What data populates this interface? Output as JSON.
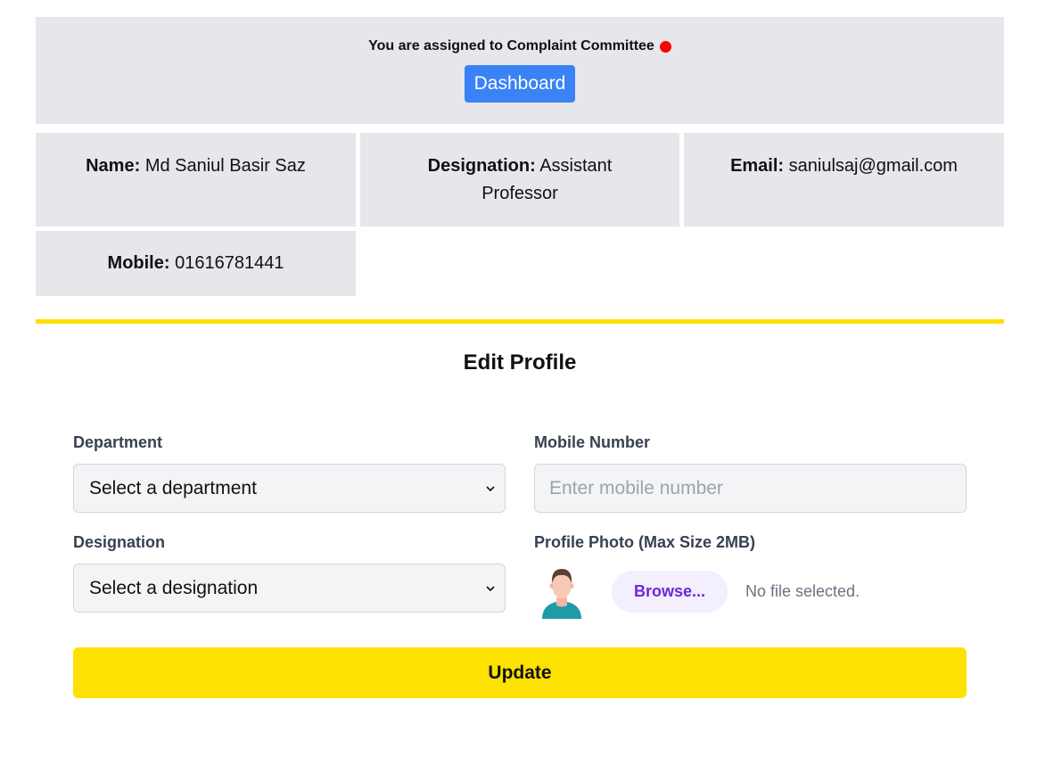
{
  "banner": {
    "assignment_text": "You are assigned to Complaint Committee",
    "status_dot_color": "#ff0000",
    "dashboard_label": "Dashboard"
  },
  "profile": {
    "name_label": "Name:",
    "name_value": "Md Saniul Basir Saz",
    "designation_label": "Designation:",
    "designation_value": "Assistant Professor",
    "email_label": "Email:",
    "email_value": "saniulsaj@gmail.com",
    "mobile_label": "Mobile:",
    "mobile_value": "01616781441"
  },
  "form": {
    "title": "Edit Profile",
    "department_label": "Department",
    "department_selected": "Select a department",
    "mobile_label": "Mobile Number",
    "mobile_value": "",
    "mobile_placeholder": "Enter mobile number",
    "designation_label": "Designation",
    "designation_selected": "Select a designation",
    "photo_label": "Profile Photo (Max Size 2MB)",
    "browse_label": "Browse...",
    "file_status": "No file selected.",
    "update_label": "Update"
  },
  "colors": {
    "accent_yellow": "#fde100",
    "dashboard_blue": "#3b82f6",
    "browse_purple": "#6d28d9"
  },
  "icons": {
    "avatar": "user-avatar-icon",
    "select_chevron": "chevron-down-icon"
  }
}
